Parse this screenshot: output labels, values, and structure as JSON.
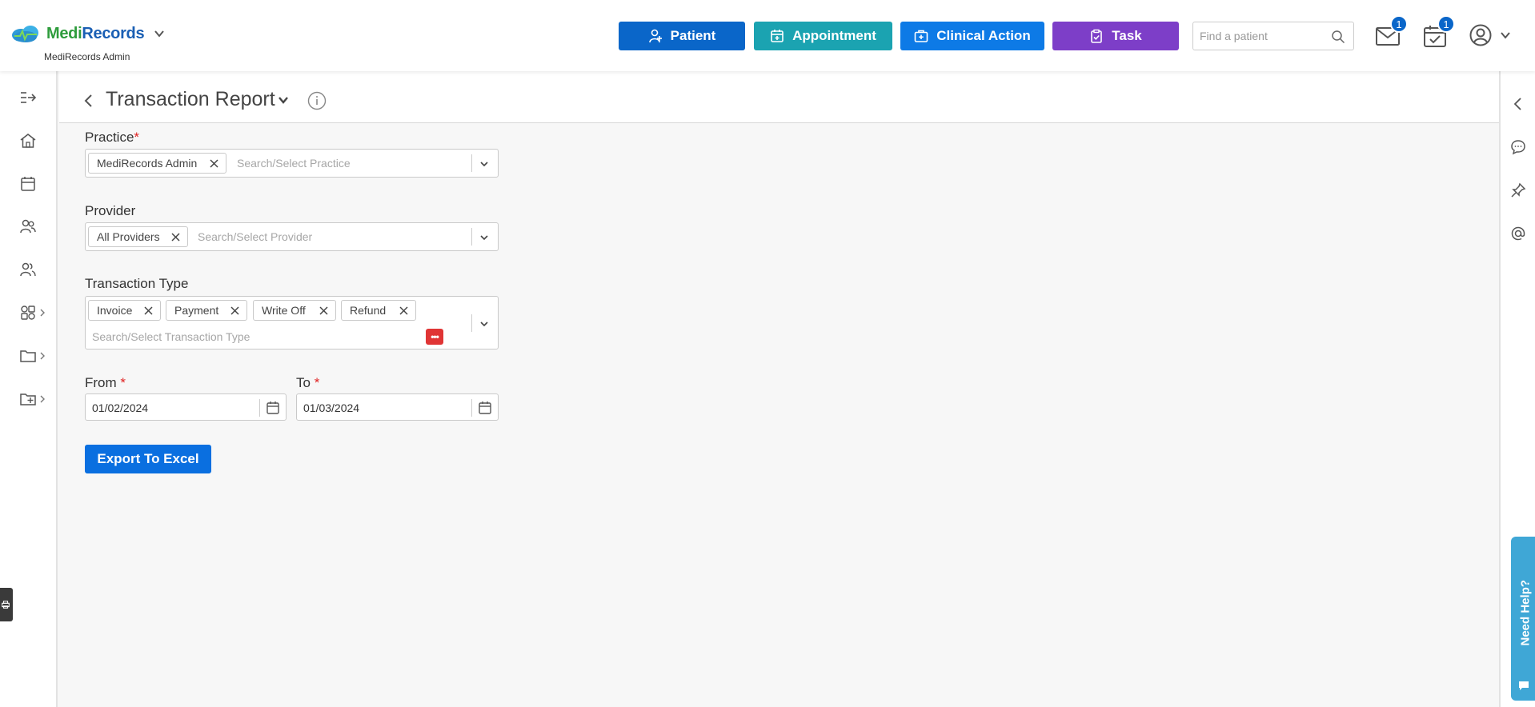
{
  "header": {
    "brand_name_part1": "Medi",
    "brand_name_part2": "Records",
    "brand_sub": "MediRecords Admin",
    "buttons": {
      "patient": "Patient",
      "appointment": "Appointment",
      "clinical_action": "Clinical Action",
      "task": "Task"
    },
    "search_placeholder": "Find a patient",
    "mail_badge": "1",
    "calendar_badge": "1"
  },
  "page": {
    "title": "Transaction Report"
  },
  "form": {
    "practice": {
      "label": "Practice",
      "required_mark": "*",
      "chips": [
        "MediRecords Admin"
      ],
      "placeholder": "Search/Select Practice"
    },
    "provider": {
      "label": "Provider",
      "chips": [
        "All Providers"
      ],
      "placeholder": "Search/Select Provider"
    },
    "transaction_type": {
      "label": "Transaction Type",
      "chips": [
        "Invoice",
        "Payment",
        "Write Off",
        "Refund"
      ],
      "placeholder": "Search/Select Transaction Type",
      "more_badge": "•••"
    },
    "from": {
      "label": "From",
      "required_mark": "*",
      "value": "01/02/2024"
    },
    "to": {
      "label": "To",
      "required_mark": "*",
      "value": "01/03/2024"
    },
    "export_button": "Export To Excel"
  },
  "help_tab": "Need Help?",
  "colors": {
    "patient_btn": "#0a66c9",
    "appointment_btn": "#1ba3b1",
    "clinical_btn": "#0d7ae6",
    "task_btn": "#7d3ec8",
    "export_btn": "#0a6fe0",
    "required": "#e02424"
  }
}
